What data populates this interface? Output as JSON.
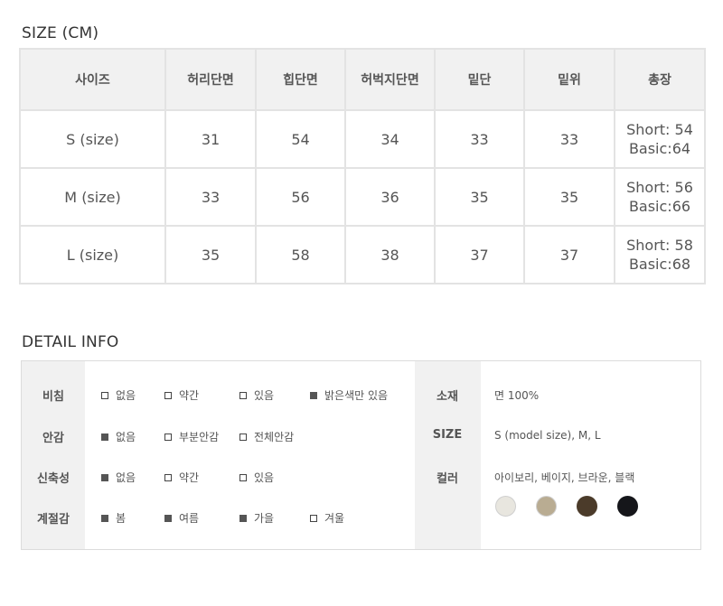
{
  "size_section": {
    "title": "SIZE (CM)",
    "headers": [
      "사이즈",
      "허리단면",
      "힙단면",
      "허벅지단면",
      "밑단",
      "밑위",
      "총장"
    ],
    "rows": [
      {
        "size": "S (size)",
        "waist": "31",
        "hip": "54",
        "thigh": "34",
        "hem": "33",
        "rise": "33",
        "total_short": "Short: 54",
        "total_basic": "Basic:64"
      },
      {
        "size": "M (size)",
        "waist": "33",
        "hip": "56",
        "thigh": "36",
        "hem": "35",
        "rise": "35",
        "total_short": "Short: 56",
        "total_basic": "Basic:66"
      },
      {
        "size": "L (size)",
        "waist": "35",
        "hip": "58",
        "thigh": "38",
        "hem": "37",
        "rise": "37",
        "total_short": "Short: 58",
        "total_basic": "Basic:68"
      }
    ]
  },
  "detail_section": {
    "title": "DETAIL INFO",
    "attributes": [
      {
        "label": "비침",
        "options": [
          {
            "text": "없음",
            "checked": false
          },
          {
            "text": "약간",
            "checked": false
          },
          {
            "text": "있음",
            "checked": false
          },
          {
            "text": "밝은색만 있음",
            "checked": true
          }
        ]
      },
      {
        "label": "안감",
        "options": [
          {
            "text": "없음",
            "checked": true
          },
          {
            "text": "부분안감",
            "checked": false
          },
          {
            "text": "전체안감",
            "checked": false
          }
        ]
      },
      {
        "label": "신축성",
        "options": [
          {
            "text": "없음",
            "checked": true
          },
          {
            "text": "약간",
            "checked": false
          },
          {
            "text": "있음",
            "checked": false
          }
        ]
      },
      {
        "label": "계절감",
        "options": [
          {
            "text": "봄",
            "checked": true
          },
          {
            "text": "여름",
            "checked": true
          },
          {
            "text": "가을",
            "checked": true
          },
          {
            "text": "겨울",
            "checked": false
          }
        ]
      }
    ],
    "info": {
      "material_label": "소재",
      "material_value": "면 100%",
      "size_label": "SIZE",
      "size_value": "S (model size), M, L",
      "color_label": "컬러",
      "color_value": "아이보리, 베이지, 브라운, 블랙",
      "swatches": [
        "#e8e6df",
        "#b9ac92",
        "#4b3b2a",
        "#15161a"
      ]
    }
  }
}
